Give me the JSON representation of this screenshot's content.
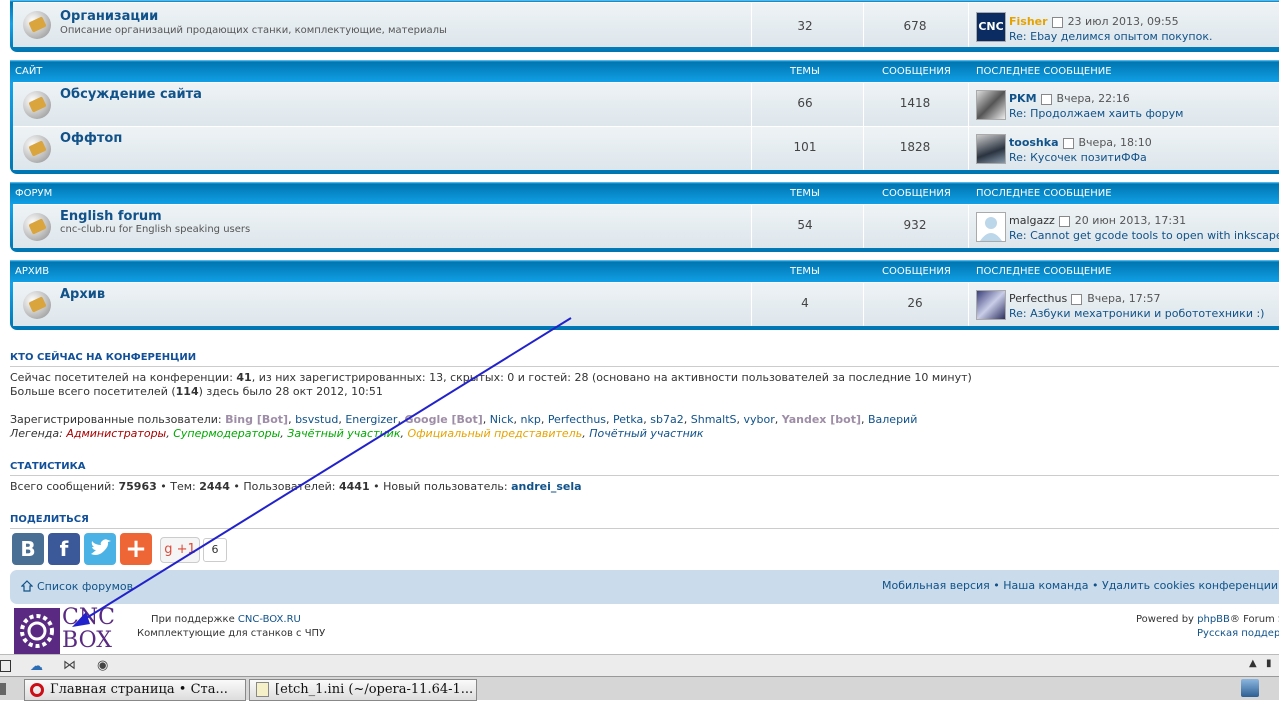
{
  "forums_top": {
    "name": "Организации",
    "desc": "Описание организаций продающих станки, комплектующие, материалы",
    "topics": "32",
    "posts": "678",
    "lp_user": "Fisher",
    "lp_date": "23 июл 2013, 09:55",
    "lp_topic": "Re: Ebay делимся опытом покупок."
  },
  "headers": {
    "topics": "ТЕМЫ",
    "posts": "СООБЩЕНИЯ",
    "last": "ПОСЛЕДНЕЕ СООБЩЕНИЕ"
  },
  "cat_site": {
    "title": "САЙТ",
    "forums": [
      {
        "name": "Обсуждение сайта",
        "topics": "66",
        "posts": "1418",
        "lp_user": "PKM",
        "lp_date": "Вчера, 22:16",
        "lp_topic": "Re: Продолжаем хаить форум"
      },
      {
        "name": "Оффтоп",
        "topics": "101",
        "posts": "1828",
        "lp_user": "tooshka",
        "lp_date": "Вчера, 18:10",
        "lp_topic": "Re: Кусочек позитиФФа"
      }
    ]
  },
  "cat_forum": {
    "title": "ФОРУМ",
    "forums": [
      {
        "name": "English forum",
        "desc": "cnc-club.ru for English speaking users",
        "topics": "54",
        "posts": "932",
        "lp_user": "malgazz",
        "lp_date": "20 июн 2013, 17:31",
        "lp_topic": "Re: Cannot get gcode tools to open with inkscape"
      }
    ]
  },
  "cat_archive": {
    "title": "АРХИВ",
    "forums": [
      {
        "name": "Архив",
        "topics": "4",
        "posts": "26",
        "lp_user": "Perfecthus",
        "lp_date": "Вчера, 17:57",
        "lp_topic": "Re: Азбуки мехатроники и робототехники :)"
      }
    ]
  },
  "online": {
    "title": "КТО СЕЙЧАС НА КОНФЕРЕНЦИИ",
    "line1_pre": "Сейчас посетителей на конференции: ",
    "line1_num": "41",
    "line1_post": ", из них зарегистрированных: 13, скрытых: 0 и гостей: 28 (основано на активности пользователей за последние 10 минут)",
    "line2_pre": "Больше всего посетителей (",
    "line2_num": "114",
    "line2_post": ") здесь было 28 окт 2012, 10:51",
    "reg_label": "Зарегистрированные пользователи: ",
    "users": [
      {
        "n": "Bing [Bot]",
        "bot": true
      },
      {
        "n": "bsvstud"
      },
      {
        "n": "Energizer"
      },
      {
        "n": "Google [Bot]",
        "bot": true
      },
      {
        "n": "Nick"
      },
      {
        "n": "nkp"
      },
      {
        "n": "Perfecthus"
      },
      {
        "n": "Petka"
      },
      {
        "n": "sb7a2"
      },
      {
        "n": "ShmaltS"
      },
      {
        "n": "vybor"
      },
      {
        "n": "Yandex [bot]",
        "bot": true
      },
      {
        "n": "Валерий"
      }
    ],
    "legend_label": "Легенда: ",
    "legend": [
      {
        "n": "Администраторы",
        "c": "#aa0000"
      },
      {
        "n": "Супермодераторы",
        "c": "#00aa00"
      },
      {
        "n": "Зачётный участник",
        "c": "#00aa00"
      },
      {
        "n": "Официальный представитель",
        "c": "#e6a300"
      },
      {
        "n": "Почётный участник",
        "c": "#105289"
      }
    ]
  },
  "stats": {
    "title": "СТАТИСТИКА",
    "pre1": "Всего сообщений: ",
    "posts": "75963",
    "pre2": " • Тем: ",
    "topics": "2444",
    "pre3": " • Пользователей: ",
    "users": "4441",
    "pre4": " • Новый пользователь: ",
    "newuser": "andrei_sela"
  },
  "share": {
    "title": "ПОДЕЛИТЬСЯ",
    "vk": "B",
    "fb": "f",
    "plus": "+",
    "gplus": "g +1",
    "gcount": "6",
    "colors": {
      "vk": "#4a6f94",
      "fb": "#3b5998",
      "tw": "#4ab2e4",
      "plus": "#ef6636"
    }
  },
  "navbar": {
    "left": "Список форумов",
    "right": "Мобильная версия • Наша команда • Удалить cookies конференции • Часовой"
  },
  "footer": {
    "logo1": "CNC",
    "logo2": "BOX",
    "support_pre": "При поддержке ",
    "support_link": "CNC-BOX.RU",
    "support_line2": "Комплектующие для станков с ЧПУ",
    "powered_pre": "Powered by ",
    "powered_link": "phpBB",
    "powered_post": "® Forum Sc",
    "russian": "Русская поддерж"
  },
  "taskbar": {
    "btn1": "Главная страница • Ста...",
    "btn2": "[etch_1.ini (~/opera-11.64-1..."
  }
}
